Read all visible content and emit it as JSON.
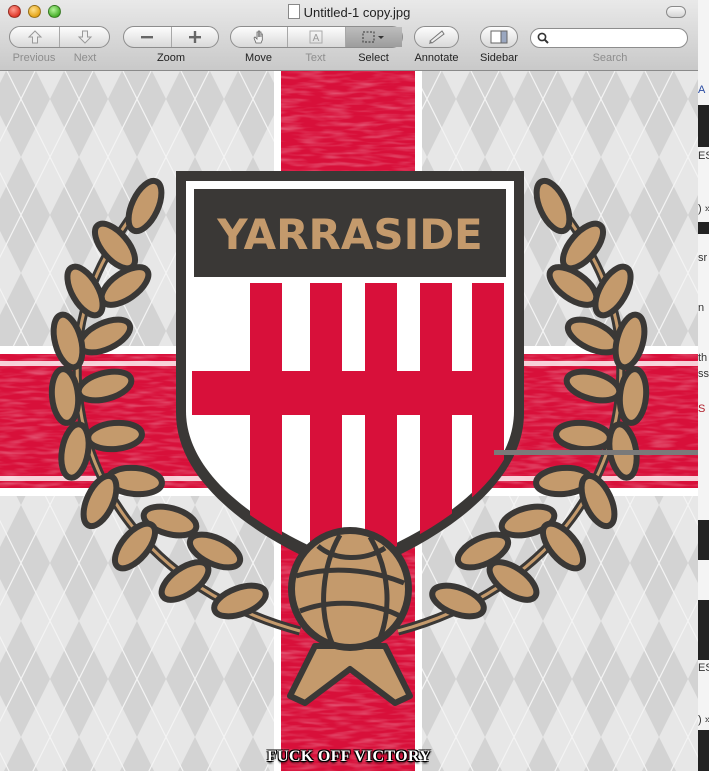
{
  "window": {
    "title": "Untitled-1 copy.jpg"
  },
  "toolbar": {
    "previous_label": "Previous",
    "next_label": "Next",
    "zoom_label": "Zoom",
    "move_label": "Move",
    "text_label": "Text",
    "select_label": "Select",
    "annotate_label": "Annotate",
    "sidebar_label": "Sidebar",
    "search_label": "Search",
    "search_value": ""
  },
  "icons": [
    "up-arrow-icon",
    "down-arrow-icon",
    "zoom-out-icon",
    "zoom-in-icon",
    "hand-icon",
    "text-tool-icon",
    "select-rect-icon",
    "pencil-icon",
    "sidebar-icon",
    "search-icon"
  ],
  "image": {
    "crest_name": "YARRASIDE",
    "caption": "FUCK OFF VICTORY",
    "colors": {
      "red": "#d8103a",
      "dark": "#3a3836",
      "gold": "#c49a6c",
      "argyle_light": "#e6e6e6",
      "argyle_dark": "#d2d2d2"
    }
  },
  "background_window": {
    "fragments": [
      "A",
      "ES",
      ") »",
      "sr",
      "n",
      "th",
      "ss",
      "S",
      "ES",
      ") »"
    ]
  }
}
